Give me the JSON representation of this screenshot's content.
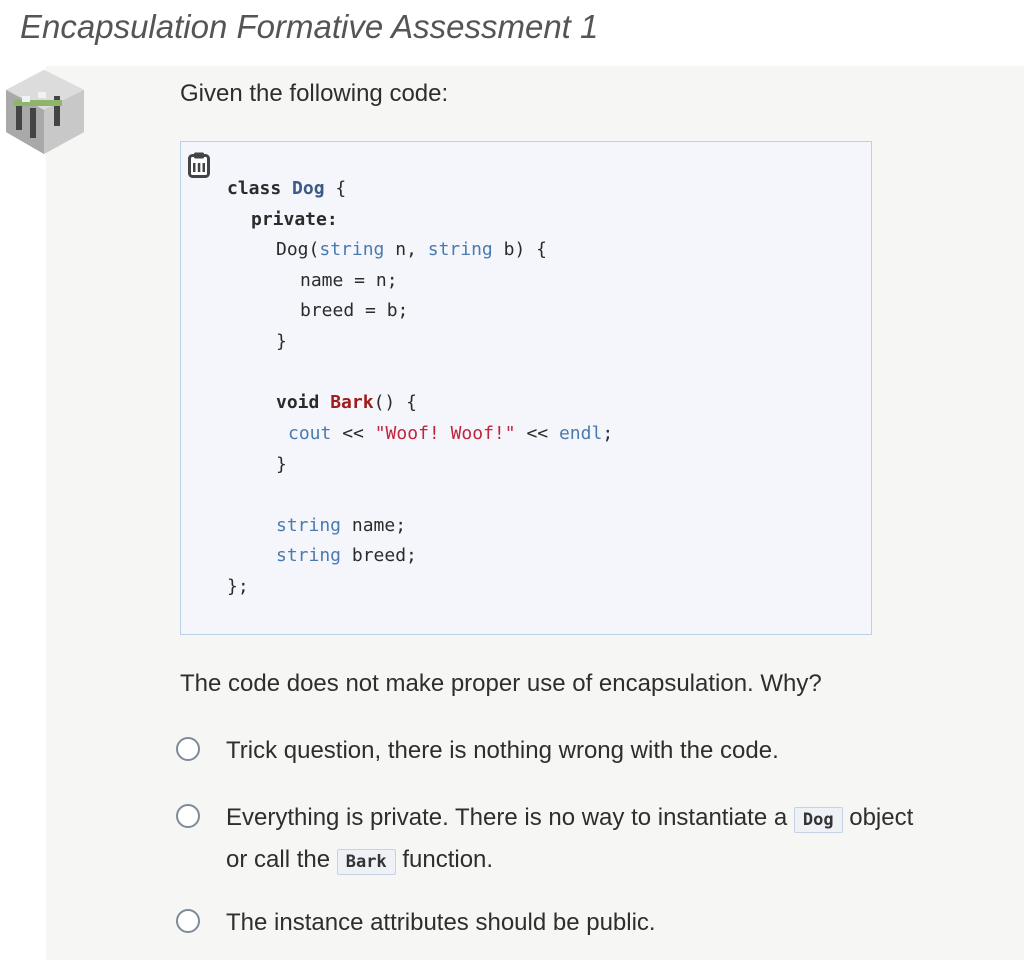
{
  "title": "Encapsulation Formative Assessment 1",
  "prompt": "Given the following code:",
  "code": {
    "l1_kw": "class",
    "l1_cls": "Dog",
    "l1_rest": " {",
    "l2_kw": "private:",
    "l3_a": "Dog(",
    "l3_t1": "string",
    "l3_b": " n, ",
    "l3_t2": "string",
    "l3_c": " b) {",
    "l4": "name = n;",
    "l5": "breed = b;",
    "l6": "}",
    "l7_kw": "void",
    "l7_fn": "Bark",
    "l7_rest": "() {",
    "l8_t": "cout",
    "l8_a": " << ",
    "l8_s": "\"Woof! Woof!\"",
    "l8_b": " << ",
    "l8_e": "endl",
    "l8_c": ";",
    "l9": "}",
    "l10_t": "string",
    "l10_r": " name;",
    "l11_t": "string",
    "l11_r": " breed;",
    "l12": "};"
  },
  "question": "The code does not make proper use of encapsulation. Why?",
  "options": [
    {
      "text": "Trick question, there is nothing wrong with the code."
    },
    {
      "pre": "Everything is private. There is no way to instantiate a ",
      "code1": "Dog",
      "mid": " object or call the ",
      "code2": "Bark",
      "post": " function."
    },
    {
      "text": "The instance attributes should be public."
    }
  ],
  "icons": {
    "thumbnail": "cube-thumbnail-icon",
    "clipboard": "clipboard-icon",
    "radio": "radio-unchecked-icon"
  },
  "colors": {
    "keyword_type": "#4a7bb0",
    "function": "#a11b1b",
    "string": "#c0243e",
    "class": "#3b5b86"
  }
}
